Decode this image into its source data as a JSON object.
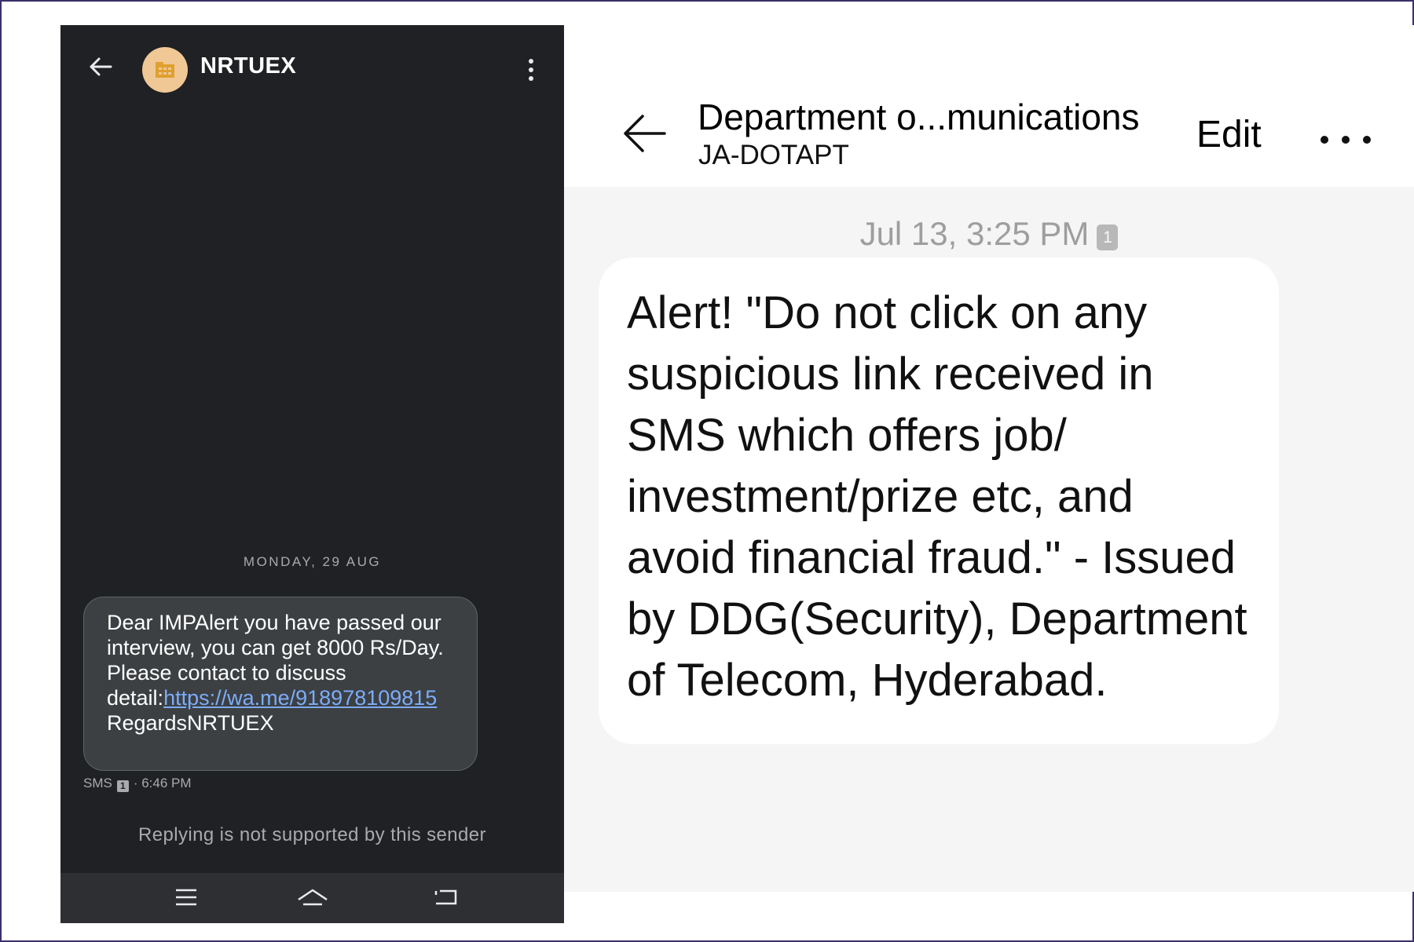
{
  "left_phone": {
    "header": {
      "title": "NRTUEX",
      "back_icon": "arrow-left-icon",
      "avatar_icon": "business-building-icon",
      "menu_icon": "vertical-dots-icon"
    },
    "date_divider": "MONDAY, 29 AUG",
    "message": {
      "text_before_link": "Dear IMPAlert you have passed our interview, you can get 8000 Rs/Day. Please contact to discuss detail:",
      "link": "https://wa.me/918978109815",
      "text_after_link": " RegardsNRTUEX"
    },
    "meta": {
      "channel": "SMS",
      "sim_label": "1",
      "time": "· 6:46 PM"
    },
    "reply_notice": "Replying is not supported by this sender",
    "nav_bar": [
      "menu-lines-icon",
      "home-icon",
      "back-return-icon"
    ]
  },
  "right_phone": {
    "header": {
      "title": "Department o...munications",
      "subtitle": "JA-DOTAPT",
      "edit_label": "Edit",
      "back_icon": "arrow-left-icon",
      "more_icon": "horizontal-dots-icon"
    },
    "timestamp": "Jul 13, 3:25 PM",
    "sim_label": "1",
    "message_lines": [
      "Alert! \"Do not click on any",
      "suspicious link received in",
      "SMS which offers job/",
      "investment/prize etc, and",
      "avoid financial fraud.\" - Issued",
      "by DDG(Security), Department",
      "of Telecom, Hyderabad."
    ]
  },
  "colors": {
    "left_background": "#202124",
    "left_bubble": "#3c4043",
    "link": "#7cacf8",
    "avatar": "#f0c896",
    "right_body": "#f5f5f5",
    "frame_border": "#3b2f6b"
  }
}
